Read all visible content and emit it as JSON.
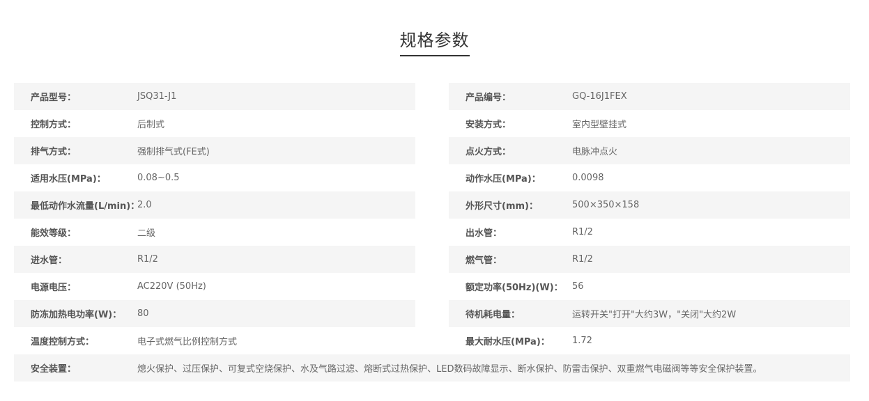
{
  "title": "规格参数",
  "left": [
    {
      "label": "产品型号：",
      "value": "JSQ31-J1"
    },
    {
      "label": "控制方式：",
      "value": "后制式"
    },
    {
      "label": "排气方式：",
      "value": "强制排气式(FE式)"
    },
    {
      "label": "适用水压(MPa)：",
      "value": "0.08~0.5"
    },
    {
      "label": "最低动作水流量(L/min)：",
      "value": "2.0"
    },
    {
      "label": "能效等级：",
      "value": "二级"
    },
    {
      "label": "进水管：",
      "value": "R1/2"
    },
    {
      "label": "电源电压：",
      "value": "AC220V (50Hz)"
    },
    {
      "label": "防冻加热电功率(W)：",
      "value": "80"
    },
    {
      "label": "温度控制方式：",
      "value": "电子式燃气比例控制方式"
    }
  ],
  "right": [
    {
      "label": "产品编号：",
      "value": "GQ-16J1FEX"
    },
    {
      "label": "安装方式：",
      "value": "室内型壁挂式"
    },
    {
      "label": "点火方式：",
      "value": "电脉冲点火"
    },
    {
      "label": "动作水压(MPa)：",
      "value": "0.0098"
    },
    {
      "label": "外形尺寸(mm)：",
      "value": "500×350×158"
    },
    {
      "label": "出水管：",
      "value": "R1/2"
    },
    {
      "label": "燃气管：",
      "value": " R1/2"
    },
    {
      "label": "额定功率(50Hz)(W)：",
      "value": " 56"
    },
    {
      "label": "待机耗电量：",
      "value": "运转开关\"打开\"大约3W，\"关闭\"大约2W"
    },
    {
      "label": "最大耐水压(MPa)：",
      "value": "1.72"
    }
  ],
  "safety": {
    "label": "安全装置：",
    "value": "熄火保护、过压保护、可复式空烧保护、水及气路过滤、熔断式过热保护、LED数码故障显示、断水保护、防雷击保护、双重燃气电磁阀等等安全保护装置。"
  }
}
